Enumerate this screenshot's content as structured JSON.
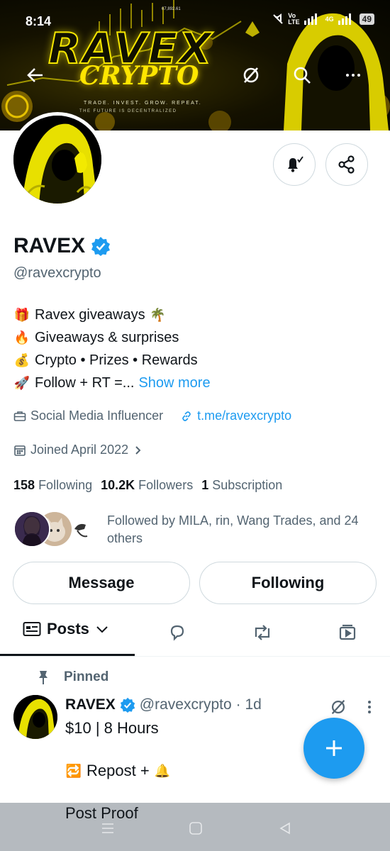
{
  "status_bar": {
    "time": "8:14",
    "network_top": "Vo",
    "network_bottom": "LTE",
    "signal_label": "4G",
    "battery": "49"
  },
  "banner": {
    "title": "RAVEX",
    "subtitle": "CRYPTO",
    "tagline": "TRADE. INVEST. GROW. REPEAT.",
    "tagline2": "THE FUTURE IS DECENTRALIZED",
    "price_text": "67,892.61"
  },
  "header_buttons": {
    "back": "arrow-left-icon",
    "grok": "grok-icon",
    "search": "search-icon",
    "more": "more-icon"
  },
  "profile": {
    "name": "RAVEX",
    "handle": "@ravexcrypto",
    "bio": [
      {
        "emoji": "🎁",
        "text": "Ravex giveaways",
        "trail": "🌴"
      },
      {
        "emoji": "🔥",
        "text": "Giveaways & surprises",
        "trail": ""
      },
      {
        "emoji": "💰",
        "text": "Crypto • Prizes • Rewards",
        "trail": ""
      },
      {
        "emoji": "🚀",
        "text": "Follow + RT =...",
        "trail": ""
      }
    ],
    "show_more": "Show more",
    "category": "Social Media Influencer",
    "link": "t.me/ravexcrypto",
    "joined": "Joined April 2022",
    "following_count": "158",
    "following_label": "Following",
    "followers_count": "10.2K",
    "followers_label": "Followers",
    "subscription_count": "1",
    "subscription_label": "Subscription",
    "followed_by": "Followed by MILA, rin, Wang Trades, and 24 others"
  },
  "actions": {
    "message": "Message",
    "following": "Following"
  },
  "tabs": {
    "posts": "Posts"
  },
  "pinned_post": {
    "pinned_label": "Pinned",
    "author": "RAVEX",
    "handle": "@ravexcrypto",
    "time": "· 1d",
    "line1": "$10 |  8 Hours",
    "line2": "Repost +",
    "line2_emoji_before": "🔁",
    "line2_emoji_after": "🔔",
    "line3": "Post Proof"
  },
  "colors": {
    "accent": "#1d9bf0",
    "text": "#0f1419",
    "muted": "#536471",
    "border": "#cfd9de",
    "banner_yellow": "#f5e600"
  }
}
